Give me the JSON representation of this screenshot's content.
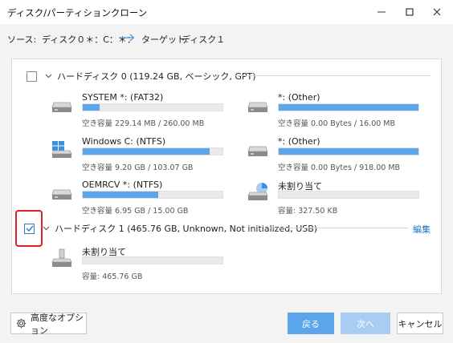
{
  "window": {
    "title": "ディスク/パーティションクローン"
  },
  "route": {
    "source_label": "ソース:",
    "source_value": "ディスク０＊：C：＊：",
    "target_label": "ターゲット:",
    "target_value": "ディスク１"
  },
  "disks": [
    {
      "title": "ハードディスク 0 (119.24 GB, ベーシック, GPT)",
      "checked": false,
      "partitions": [
        {
          "name": "SYSTEM *: (FAT32)",
          "icon": "hdd-icon",
          "used_fraction": 0.12,
          "info": "空き容量 229.14 MB / 260.00 MB"
        },
        {
          "name": "*: (Other)",
          "icon": "hdd-icon",
          "used_fraction": 1.0,
          "info": "空き容量 0.00 Bytes / 16.00 MB"
        },
        {
          "name": "Windows C: (NTFS)",
          "icon": "windows-drive-icon",
          "used_fraction": 0.91,
          "info": "空き容量 9.20 GB / 103.07 GB"
        },
        {
          "name": "*: (Other)",
          "icon": "hdd-icon",
          "used_fraction": 1.0,
          "info": "空き容量 0.00 Bytes / 918.00 MB"
        },
        {
          "name": "OEMRCV *: (NTFS)",
          "icon": "hdd-icon",
          "used_fraction": 0.54,
          "info": "空き容量 6.95 GB / 15.00 GB"
        },
        {
          "name": "未割り当て",
          "icon": "unallocated-drive-icon",
          "used_fraction": 0.0,
          "info": "容量: 327.50 KB"
        }
      ]
    },
    {
      "title": "ハードディスク 1 (465.76 GB, Unknown, Not initialized, USB)",
      "checked": true,
      "edit_label": "編集",
      "partitions": [
        {
          "name": "未割り当て",
          "icon": "unallocated-usb-icon",
          "used_fraction": 0.0,
          "info": "容量: 465.76 GB"
        }
      ]
    }
  ],
  "buttons": {
    "advanced": "高度なオプション",
    "back": "戻る",
    "next": "次へ",
    "cancel": "キャンセル"
  },
  "colors": {
    "accent": "#5aa5ec",
    "accent_disabled": "#a9cdf2",
    "highlight": "#e02020",
    "link": "#1e73c8"
  }
}
